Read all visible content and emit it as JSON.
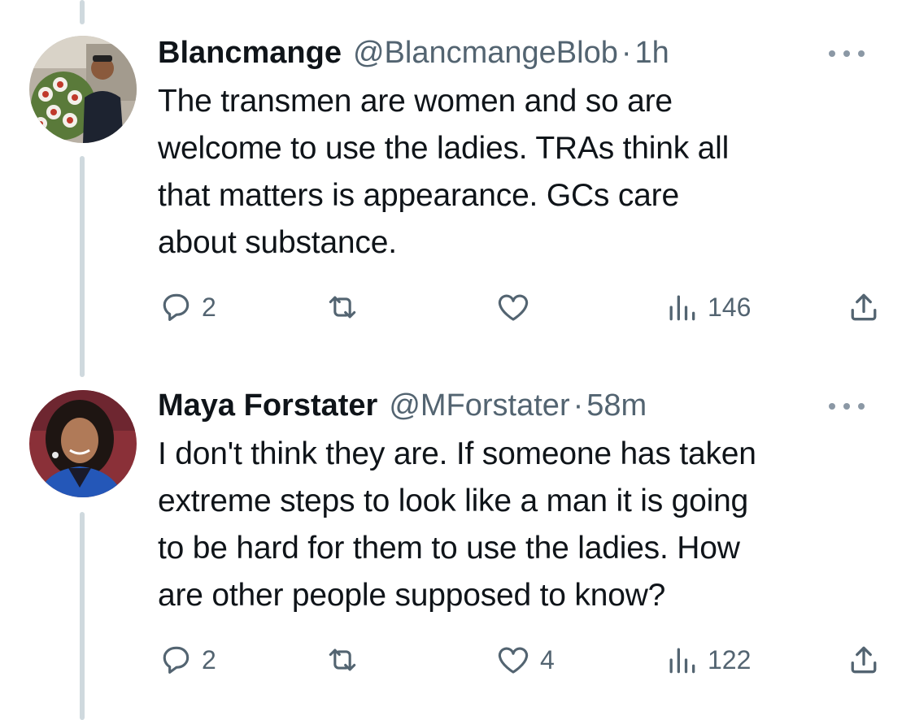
{
  "colors": {
    "text_primary": "#0f1419",
    "text_secondary": "#536471",
    "thread_line": "#cfd9de",
    "icon": "#536471"
  },
  "tweets": [
    {
      "display_name": "Blancmange",
      "handle": "@BlancmangeBlob",
      "separator": "·",
      "time": "1h",
      "text": "The transmen are women and so are\nwelcome to use the ladies. TRAs think all\nthat matters is appearance. GCs care\nabout substance.",
      "actions": {
        "reply_icon": "reply-icon",
        "reply_count": "2",
        "retweet_icon": "retweet-icon",
        "retweet_count": "",
        "like_icon": "heart-icon",
        "like_count": "",
        "views_icon": "views-icon",
        "views_count": "146",
        "share_icon": "share-icon"
      }
    },
    {
      "display_name": "Maya Forstater",
      "handle": "@MForstater",
      "separator": "·",
      "time": "58m",
      "text": "I don't think they are. If someone has taken\nextreme steps to look like a man it is going\nto be hard for them to use the ladies. How\nare other people supposed to know?",
      "actions": {
        "reply_icon": "reply-icon",
        "reply_count": "2",
        "retweet_icon": "retweet-icon",
        "retweet_count": "",
        "like_icon": "heart-icon",
        "like_count": "4",
        "views_icon": "views-icon",
        "views_count": "122",
        "share_icon": "share-icon"
      }
    }
  ]
}
